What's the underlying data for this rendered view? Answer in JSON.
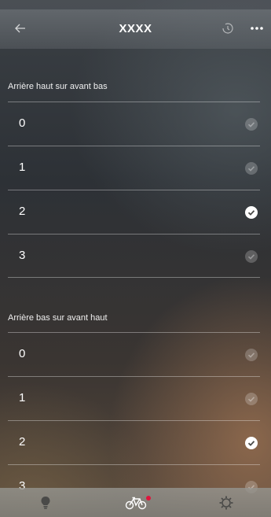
{
  "header": {
    "title": "XXXX",
    "back_icon": "arrow-left-icon",
    "history_icon": "history-icon",
    "more_icon": "more-dots-icon"
  },
  "sections": [
    {
      "label": "Arrière haut sur avant bas",
      "options": [
        {
          "label": "0",
          "selected": false
        },
        {
          "label": "1",
          "selected": false
        },
        {
          "label": "2",
          "selected": true
        },
        {
          "label": "3",
          "selected": false
        }
      ]
    },
    {
      "label": "Arrière bas sur avant haut",
      "options": [
        {
          "label": "0",
          "selected": false
        },
        {
          "label": "1",
          "selected": false
        },
        {
          "label": "2",
          "selected": true
        },
        {
          "label": "3",
          "selected": false
        }
      ]
    }
  ],
  "tabbar": {
    "tabs": [
      {
        "icon": "lightbulb-icon",
        "active": false
      },
      {
        "icon": "bike-icon",
        "active": true,
        "badge": true
      },
      {
        "icon": "gear-icon",
        "active": false
      }
    ],
    "badge_color": "#e0143c"
  }
}
